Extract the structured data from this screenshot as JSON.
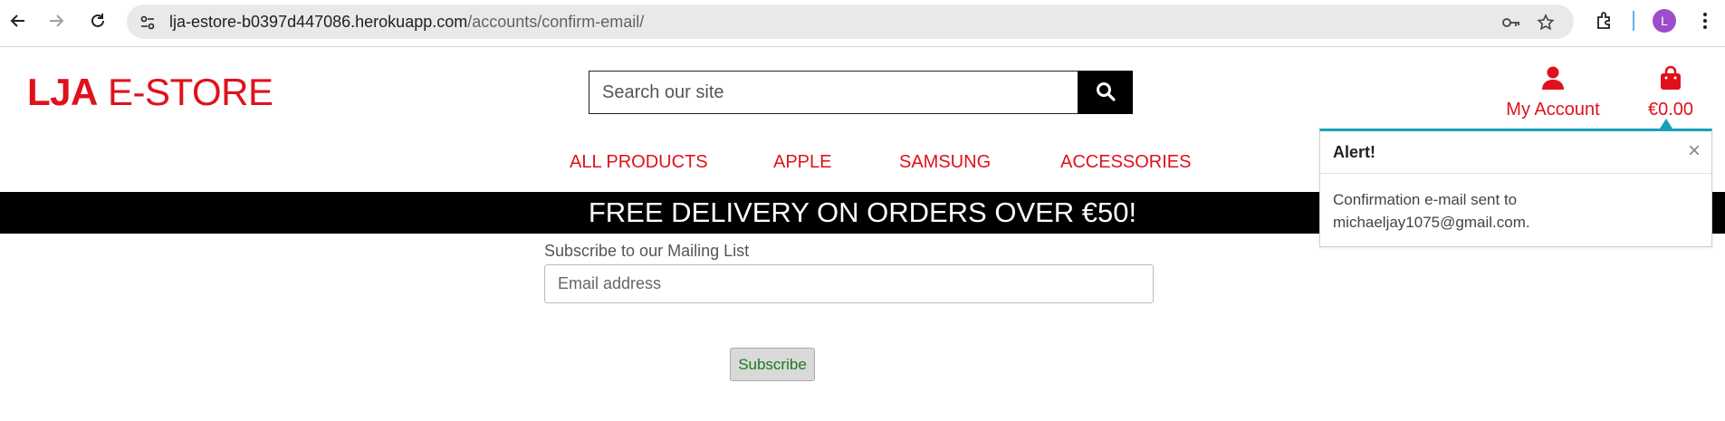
{
  "browser": {
    "url_host": "lja-estore-b0397d447086.herokuapp.com",
    "url_path": "/accounts/confirm-email/",
    "profile_initial": "L",
    "icons": [
      "back-icon",
      "forward-icon",
      "reload-icon",
      "site-settings-icon",
      "password-key-icon",
      "bookmark-star-icon",
      "extensions-icon",
      "menu-dots-icon"
    ]
  },
  "header": {
    "logo_bold": "LJA",
    "logo_light": " E-STORE",
    "search_placeholder": "Search our site",
    "account_label": "My Account",
    "bag_total": "€0.00"
  },
  "nav": {
    "items": [
      "ALL PRODUCTS",
      "APPLE",
      "SAMSUNG",
      "ACCESSORIES"
    ]
  },
  "banner": {
    "text": "FREE DELIVERY ON ORDERS OVER €50!"
  },
  "newsletter": {
    "label": "Subscribe to our Mailing List",
    "placeholder": "Email address",
    "button": "Subscribe"
  },
  "toast": {
    "title": "Alert!",
    "close": "×",
    "message_line1": "Confirmation e-mail sent to",
    "message_line2": "michaeljay1075@gmail.com."
  },
  "colors": {
    "brand_red": "#e0111b",
    "toast_accent": "#17a2b8"
  }
}
